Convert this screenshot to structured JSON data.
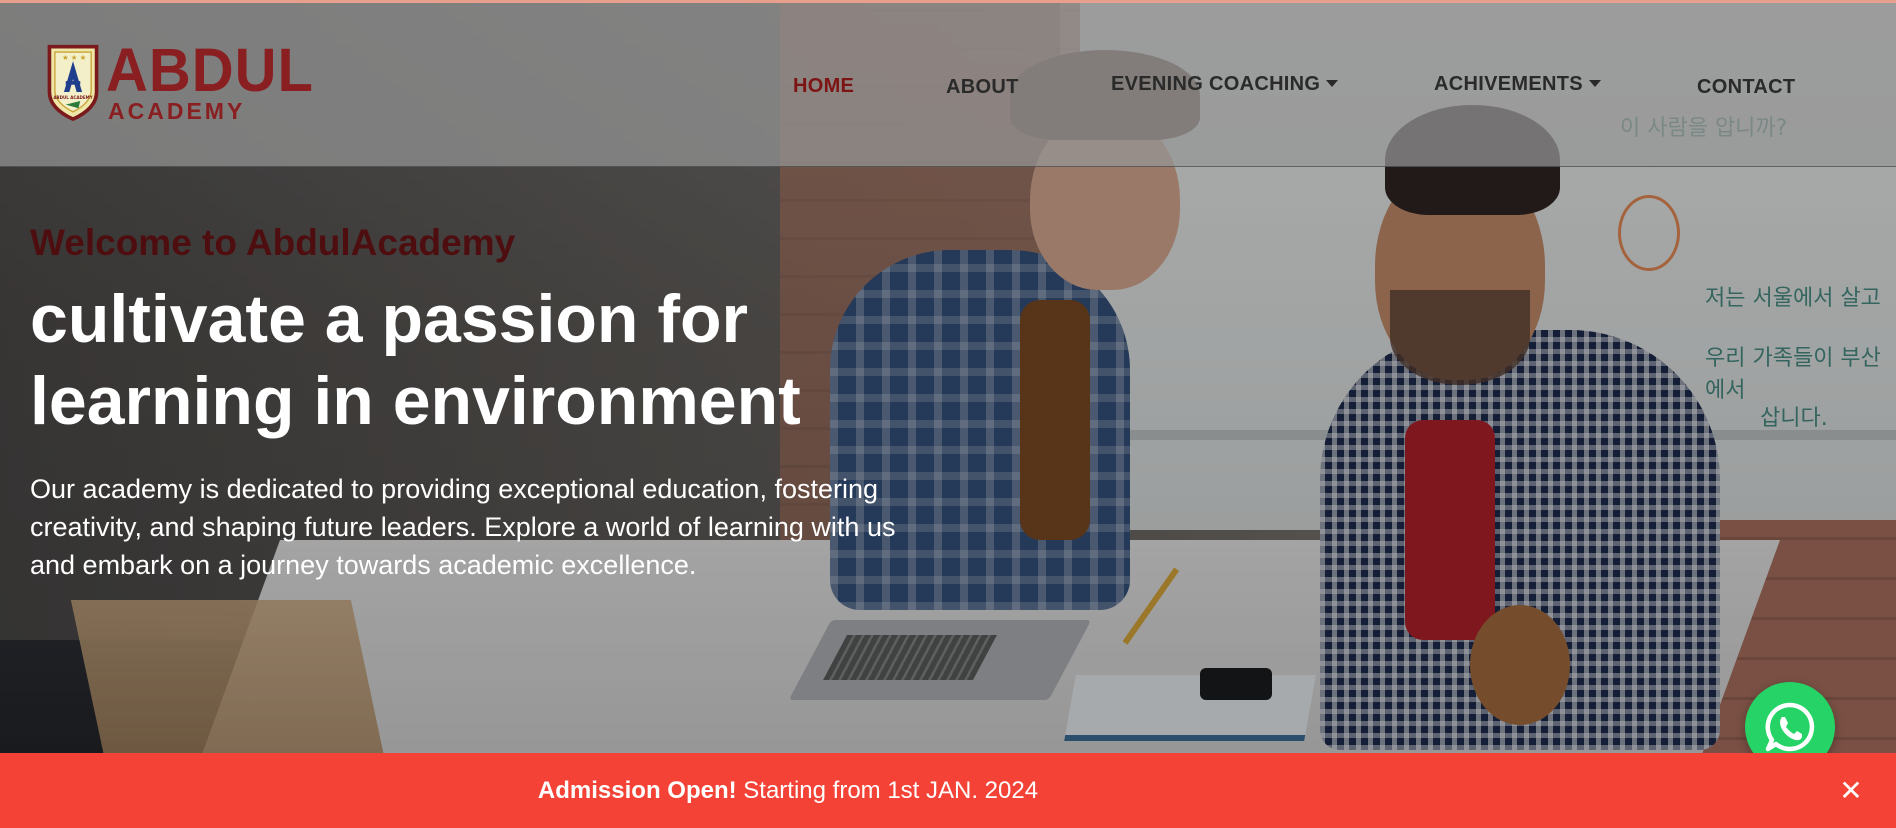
{
  "header": {
    "logo": {
      "name": "ABDUL",
      "sub": "ACADEMY",
      "crest_text": "ABDUL ACADEMY",
      "brand_color": "#8a1f22"
    },
    "nav": [
      {
        "label": "HOME",
        "active": true,
        "has_dropdown": false
      },
      {
        "label": "ABOUT",
        "active": false,
        "has_dropdown": false
      },
      {
        "label": "EVENING COACHING",
        "active": false,
        "has_dropdown": true
      },
      {
        "label": "ACHIVEMENTS",
        "active": false,
        "has_dropdown": true
      },
      {
        "label": "CONTACT",
        "active": false,
        "has_dropdown": false
      }
    ],
    "active_color": "#7d1414"
  },
  "hero": {
    "welcome": "Welcome to AbdulAcademy",
    "headline_line1": "cultivate a passion for",
    "headline_line2": "learning in environment",
    "description": "Our academy is dedicated to providing exceptional education, fostering creativity, and shaping future leaders. Explore a world of learning with us and embark on a journey towards academic excellence.",
    "welcome_color": "#4e0e10"
  },
  "whatsapp": {
    "icon": "whatsapp-icon",
    "color": "#25d366"
  },
  "banner": {
    "strong": "Admission Open!",
    "text": " Starting from 1st JAN. 2024",
    "close_icon": "close-icon",
    "color": "#f44336"
  }
}
